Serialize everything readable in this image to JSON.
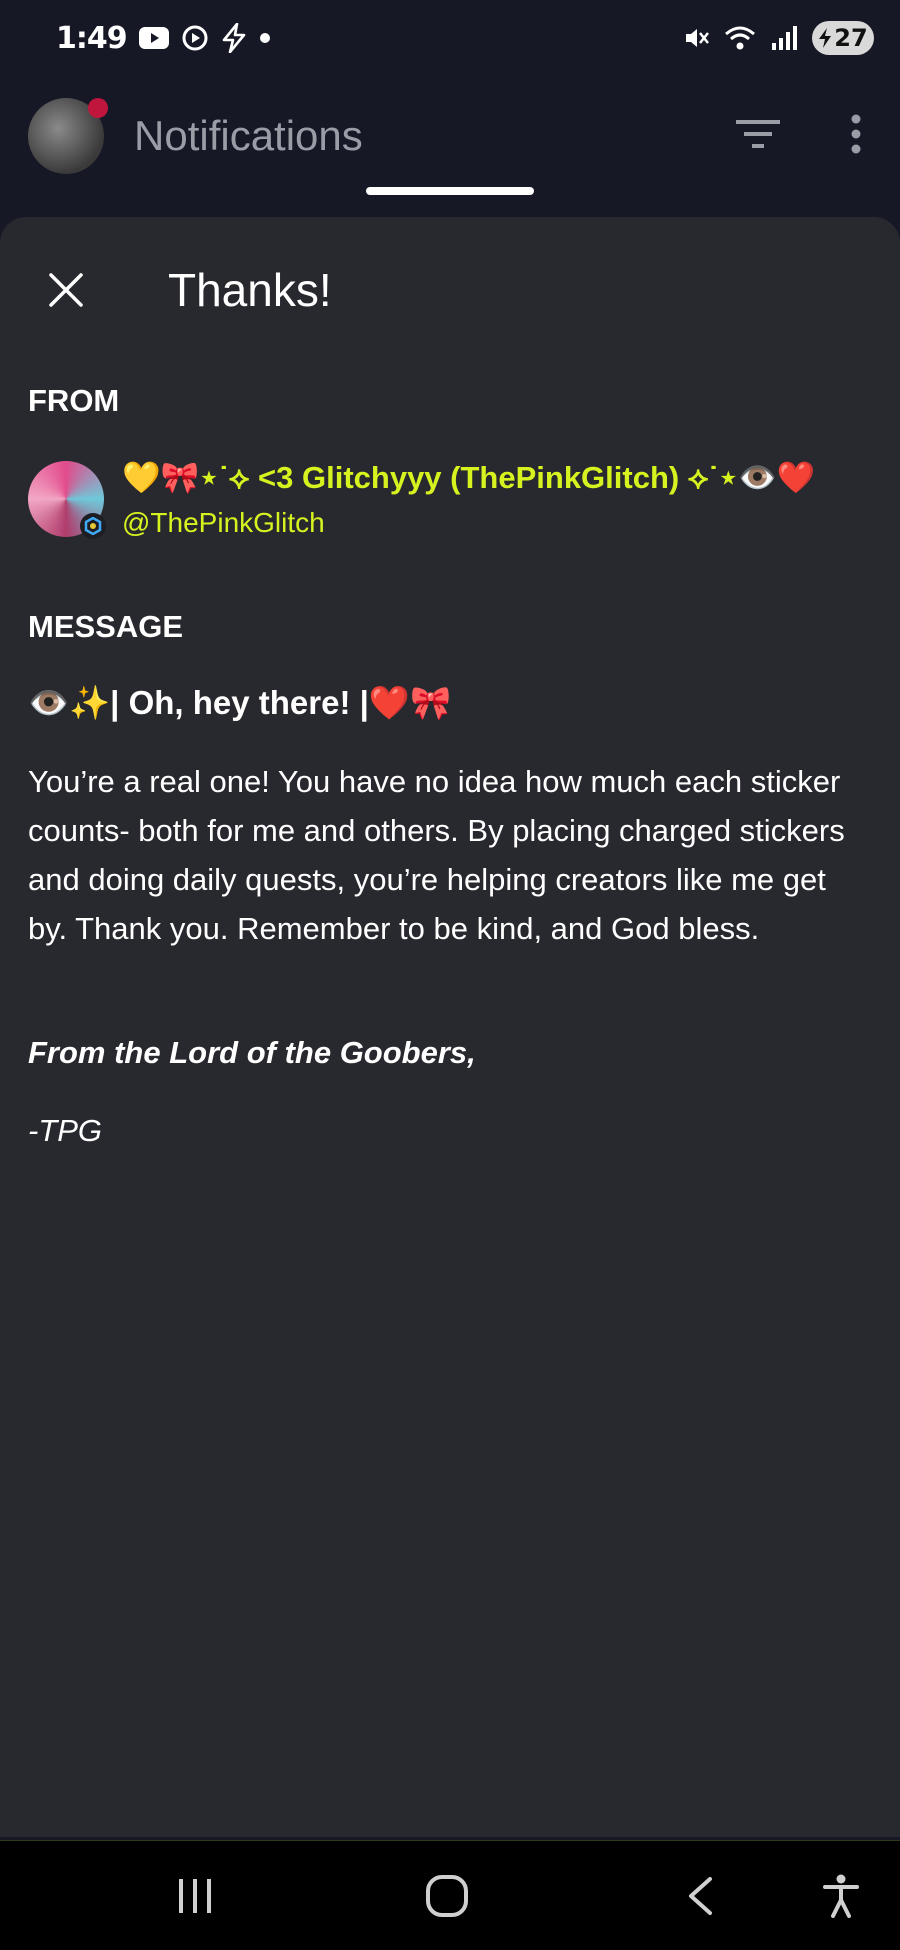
{
  "status_bar": {
    "time": "1:49",
    "battery_level": "27",
    "icons": [
      "youtube-icon",
      "record-icon",
      "bolt-icon",
      "dot-icon",
      "mute-icon",
      "wifi-icon",
      "signal-icon",
      "battery-icon"
    ]
  },
  "app_header": {
    "title": "Notifications",
    "actions": [
      "filter-icon",
      "more-vertical-icon"
    ]
  },
  "sheet": {
    "title": "Thanks!",
    "from_label": "FROM",
    "sender": {
      "display_name": "💛🎀⋆˙⟡ <3 Glitchyyy (ThePinkGlitch) ⟡˙⋆👁️❤️",
      "handle": "@ThePinkGlitch"
    },
    "message_label": "MESSAGE",
    "message": {
      "heading": "👁️✨| Oh, hey there! |❤️🎀",
      "body": "You’re a real one! You have no idea how much each sticker counts- both for me and others. By placing charged stickers and doing daily quests, you’re helping creators like me get by. Thank you. Remember to be kind, and God bless.",
      "signoff": "From the Lord of the Goobers,",
      "signature": "-TPG"
    }
  },
  "nav_bar": {
    "buttons": [
      "recents-icon",
      "home-icon",
      "back-icon",
      "accessibility-icon"
    ]
  },
  "colors": {
    "background": "#161826",
    "sheet": "#28282f",
    "accent_name": "#d6f21f",
    "notification_dot": "#c0153c"
  }
}
